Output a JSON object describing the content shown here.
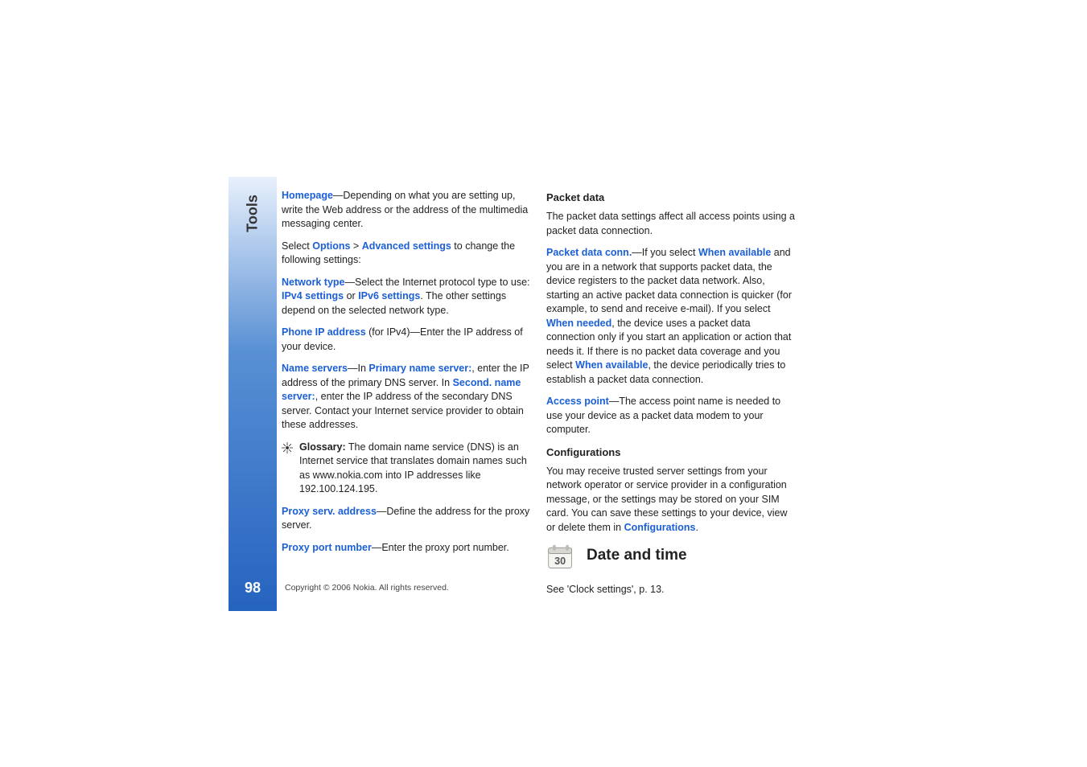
{
  "sidebar": {
    "label": "Tools",
    "page_number": "98"
  },
  "col1": {
    "homepage_label": "Homepage",
    "homepage_text": "—Depending on what you are setting up, write the Web address or the address of the multimedia messaging center.",
    "select_prefix": "Select ",
    "options_label": "Options",
    "gt": " > ",
    "advanced_label": "Advanced settings",
    "select_suffix": " to change the following settings:",
    "network_type_label": "Network type",
    "network_type_text1": "—Select the Internet protocol type to use: ",
    "ipv4_label": "IPv4 settings",
    "or": " or ",
    "ipv6_label": "IPv6 settings",
    "network_type_text2": ". The other settings depend on the selected network type.",
    "phone_ip_label": "Phone IP address",
    "phone_ip_text": " (for IPv4)—Enter the IP address of your device.",
    "name_servers_label": "Name servers",
    "name_servers_text1": "—In ",
    "primary_label": "Primary name server:",
    "name_servers_text2": ", enter the IP address of the primary DNS server. In ",
    "secondary_label": "Second. name server:",
    "name_servers_text3": ", enter the IP address of the secondary DNS server. Contact your Internet service provider to obtain these addresses.",
    "glossary_label": "Glossary:",
    "glossary_text": " The domain name service (DNS) is an Internet service that translates domain names such as www.nokia.com into IP addresses like 192.100.124.195.",
    "proxy_addr_label": "Proxy serv. address",
    "proxy_addr_text": "—Define the address for the proxy server.",
    "proxy_port_label": "Proxy port number",
    "proxy_port_text": "—Enter the proxy port number."
  },
  "col2": {
    "packet_heading": "Packet data",
    "packet_intro": "The packet data settings affect all access points using a packet data connection.",
    "pdc_label": "Packet data conn.",
    "pdc_text1": "—If you select ",
    "when_available": "When available",
    "pdc_text2": " and you are in a network that supports packet data, the device registers to the packet data network. Also, starting an active packet data connection is quicker (for example, to send and receive e-mail). If you select ",
    "when_needed": "When needed",
    "pdc_text3": ", the device uses a packet data connection only if you start an application or action that needs it. If there is no packet data coverage and you select ",
    "pdc_text4": ", the device periodically tries to establish a packet data connection.",
    "access_point_label": "Access point",
    "access_point_text": "—The access point name is needed to use your device as a packet data modem to your computer.",
    "config_heading": "Configurations",
    "config_text": "You may receive trusted server settings from your network operator or service provider in a configuration message, or the settings may be stored on your SIM card. You can save these settings to your device, view or delete them in ",
    "config_label": "Configurations",
    "config_period": ".",
    "date_heading": "Date and time",
    "date_icon_num": "30",
    "see_clock": "See 'Clock settings', p. 13."
  },
  "footer": {
    "copyright": "Copyright © 2006 Nokia. All rights reserved."
  }
}
